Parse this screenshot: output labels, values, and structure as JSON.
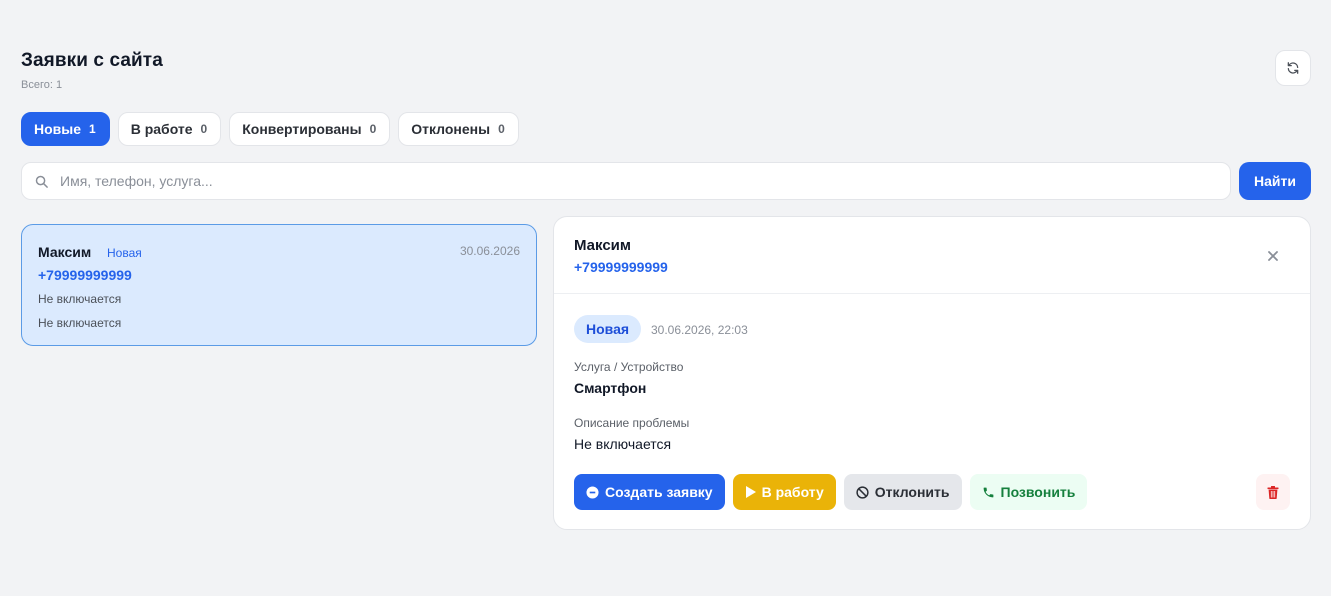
{
  "header": {
    "title": "Заявки с сайта",
    "subtitle": "Всего: 1",
    "refresh_icon": "refresh-icon"
  },
  "tabs": [
    {
      "label": "Новые",
      "count": "1",
      "active": true
    },
    {
      "label": "В работе",
      "count": "0",
      "active": false
    },
    {
      "label": "Конвертированы",
      "count": "0",
      "active": false
    },
    {
      "label": "Отклонены",
      "count": "0",
      "active": false
    }
  ],
  "search": {
    "placeholder": "Имя, телефон, услуга...",
    "value": "",
    "button_label": "Найти"
  },
  "leads": [
    {
      "name": "Максим",
      "status": "Новая",
      "date": "30.06.2026",
      "phone": "+79999999999",
      "line1": "Не включается",
      "line2": "Не включается"
    }
  ],
  "detail": {
    "name": "Максим",
    "phone": "+79999999999",
    "status_badge": "Новая",
    "datetime": "30.06.2026, 22:03",
    "service_label": "Услуга / Устройство",
    "service_value": "Смартфон",
    "problem_label": "Описание проблемы",
    "problem_value": "Не включается",
    "actions": {
      "create": "Создать заявку",
      "work": "В работу",
      "reject": "Отклонить",
      "call": "Позвонить"
    }
  },
  "colors": {
    "accent": "#2563eb",
    "selected_card_bg": "#dbeafe",
    "work": "#eab308",
    "call": "#15803d",
    "delete": "#dc2626"
  }
}
